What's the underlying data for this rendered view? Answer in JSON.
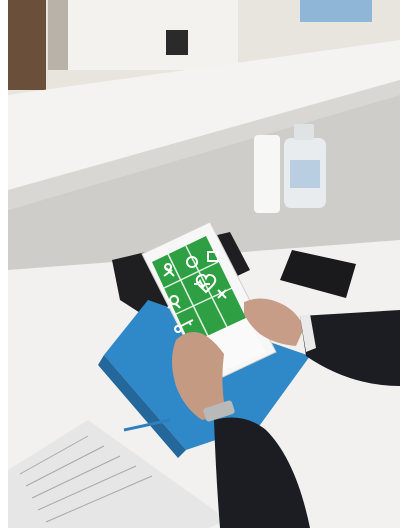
{
  "scene": {
    "description_label": "",
    "tablet_app": {
      "tiles": [
        {
          "icon": "person-move-icon"
        },
        {
          "icon": "magnifier-icon"
        },
        {
          "icon": "calendar-icon"
        },
        {
          "icon": "people-icon"
        },
        {
          "icon": "heart-pulse-icon"
        },
        {
          "icon": "tools-icon"
        },
        {
          "icon": "key-icon"
        }
      ],
      "accent_color": "#2ea043"
    },
    "colors": {
      "counter_top": "#e9e7e3",
      "desk": "#f3f3f2",
      "folder_blue": "#2f88c7",
      "sleeve_dark": "#1b1d22"
    }
  }
}
